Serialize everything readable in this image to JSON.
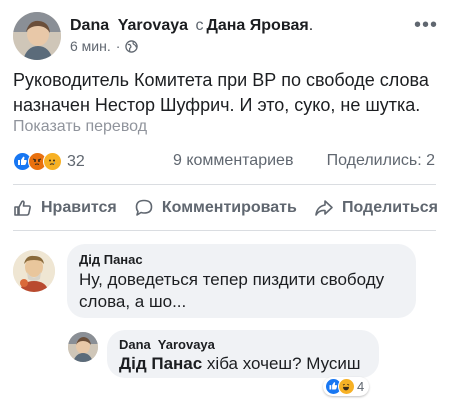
{
  "post": {
    "author": "Dana  Yarovaya",
    "with_word": "с",
    "with_name": "Дана Яровая",
    "with_suffix": ".",
    "time": "6 мин.",
    "dot": "·",
    "privacy_icon": "globe-icon",
    "more_icon": "more-dots-icon",
    "text": "Руководитель Комитета при ВР по свободе слова назначен Нестор Шуфрич. И это, суко, не шутка.",
    "translate_label": "Показать перевод"
  },
  "stats": {
    "reaction_icons": [
      "like-icon",
      "angry-icon",
      "sad-icon"
    ],
    "reaction_count": "32",
    "comments": "9 комментариев",
    "shares": "Поделились: 2"
  },
  "actions": {
    "like": "Нравится",
    "comment": "Комментировать",
    "share": "Поделиться"
  },
  "comments": [
    {
      "author": "Дід Панас",
      "text": "Ну, доведеться тепер пиздити свободу слова, а шо..."
    },
    {
      "author": "Dana  Yarovaya",
      "mention": "Дід Панас",
      "text": " хіба хочеш? Мусиш",
      "reaction_icons": [
        "like-icon",
        "laugh-icon"
      ],
      "reaction_count": "4"
    }
  ],
  "colors": {
    "link_blue": "#1877f2",
    "meta_gray": "#606770",
    "bubble_gray": "#f0f2f5",
    "angry_red": "#e9710f",
    "sad_yellow": "#f7b125"
  }
}
